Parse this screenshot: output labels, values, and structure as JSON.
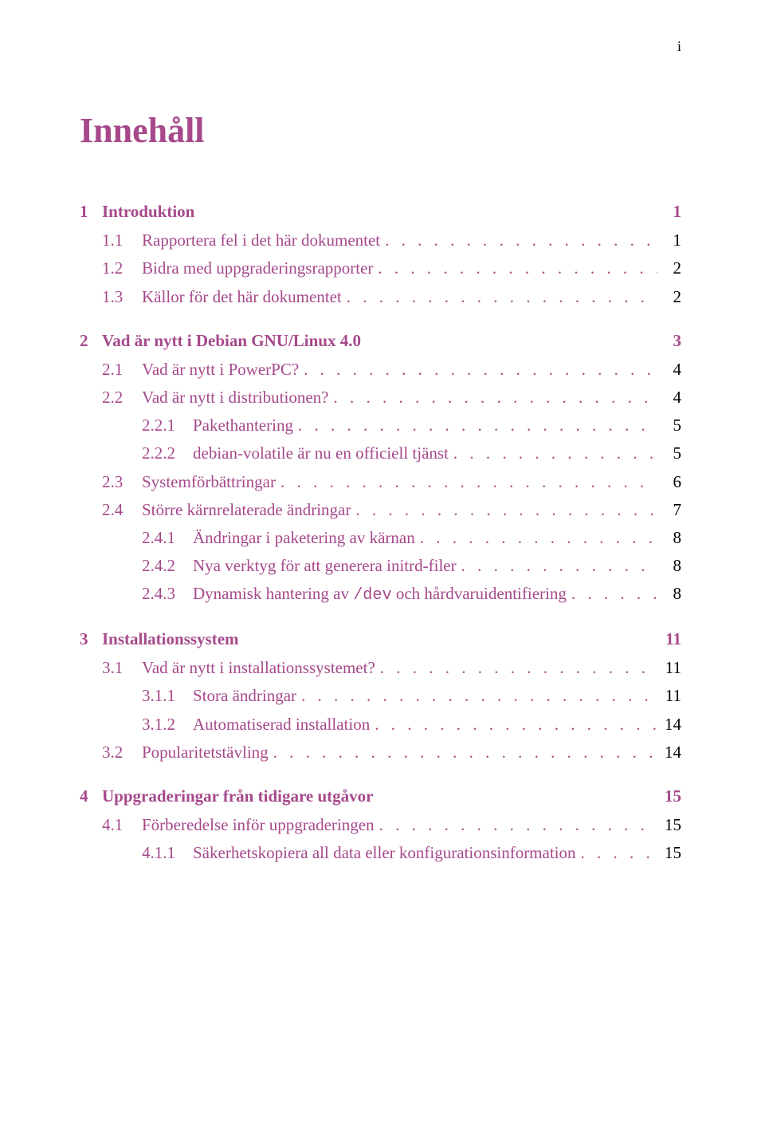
{
  "page_number_top": "i",
  "dots_fill": ". . . . . . . . . . . . . . . . . . . . . . . . . . . . . . . . . . . . . . . . . . . . . . . . . . . . . . . . . . . . . . . . . . . . .",
  "title": "Innehåll",
  "toc": [
    {
      "level": "chapter",
      "num": "1",
      "label": "Introduktion",
      "page": "1"
    },
    {
      "level": "section",
      "num": "1.1",
      "label": "Rapportera fel i det här dokumentet",
      "page": "1"
    },
    {
      "level": "section",
      "num": "1.2",
      "label": "Bidra med uppgraderingsrapporter",
      "page": "2"
    },
    {
      "level": "section",
      "num": "1.3",
      "label": "Källor för det här dokumentet",
      "page": "2"
    },
    {
      "level": "chapter",
      "num": "2",
      "label": "Vad är nytt i Debian GNU/Linux 4.0",
      "page": "3"
    },
    {
      "level": "section",
      "num": "2.1",
      "label": "Vad är nytt i PowerPC?",
      "page": "4"
    },
    {
      "level": "section",
      "num": "2.2",
      "label": "Vad är nytt i distributionen?",
      "page": "4"
    },
    {
      "level": "sub",
      "num": "2.2.1",
      "label": "Pakethantering",
      "page": "5"
    },
    {
      "level": "sub",
      "num": "2.2.2",
      "label": "debian-volatile är nu en officiell tjänst",
      "page": "5"
    },
    {
      "level": "section",
      "num": "2.3",
      "label": "Systemförbättringar",
      "page": "6"
    },
    {
      "level": "section",
      "num": "2.4",
      "label": "Större kärnrelaterade ändringar",
      "page": "7"
    },
    {
      "level": "sub",
      "num": "2.4.1",
      "label": "Ändringar i paketering av kärnan",
      "page": "8"
    },
    {
      "level": "sub",
      "num": "2.4.2",
      "label": "Nya verktyg för att generera initrd-filer",
      "page": "8"
    },
    {
      "level": "sub",
      "num": "2.4.3",
      "label_pre": "Dynamisk hantering av ",
      "label_mono": "/dev",
      "label_post": " och hårdvaruidentifiering",
      "page": "8"
    },
    {
      "level": "chapter",
      "num": "3",
      "label": "Installationssystem",
      "page": "11"
    },
    {
      "level": "section",
      "num": "3.1",
      "label": "Vad är nytt i installationssystemet?",
      "page": "11"
    },
    {
      "level": "sub",
      "num": "3.1.1",
      "label": "Stora ändringar",
      "page": "11"
    },
    {
      "level": "sub",
      "num": "3.1.2",
      "label": "Automatiserad installation",
      "page": "14"
    },
    {
      "level": "section",
      "num": "3.2",
      "label": "Popularitetstävling",
      "page": "14"
    },
    {
      "level": "chapter",
      "num": "4",
      "label": "Uppgraderingar från tidigare utgåvor",
      "page": "15"
    },
    {
      "level": "section",
      "num": "4.1",
      "label": "Förberedelse inför uppgraderingen",
      "page": "15"
    },
    {
      "level": "sub",
      "num": "4.1.1",
      "label": "Säkerhetskopiera all data eller konfigurationsinformation",
      "page": "15"
    }
  ]
}
